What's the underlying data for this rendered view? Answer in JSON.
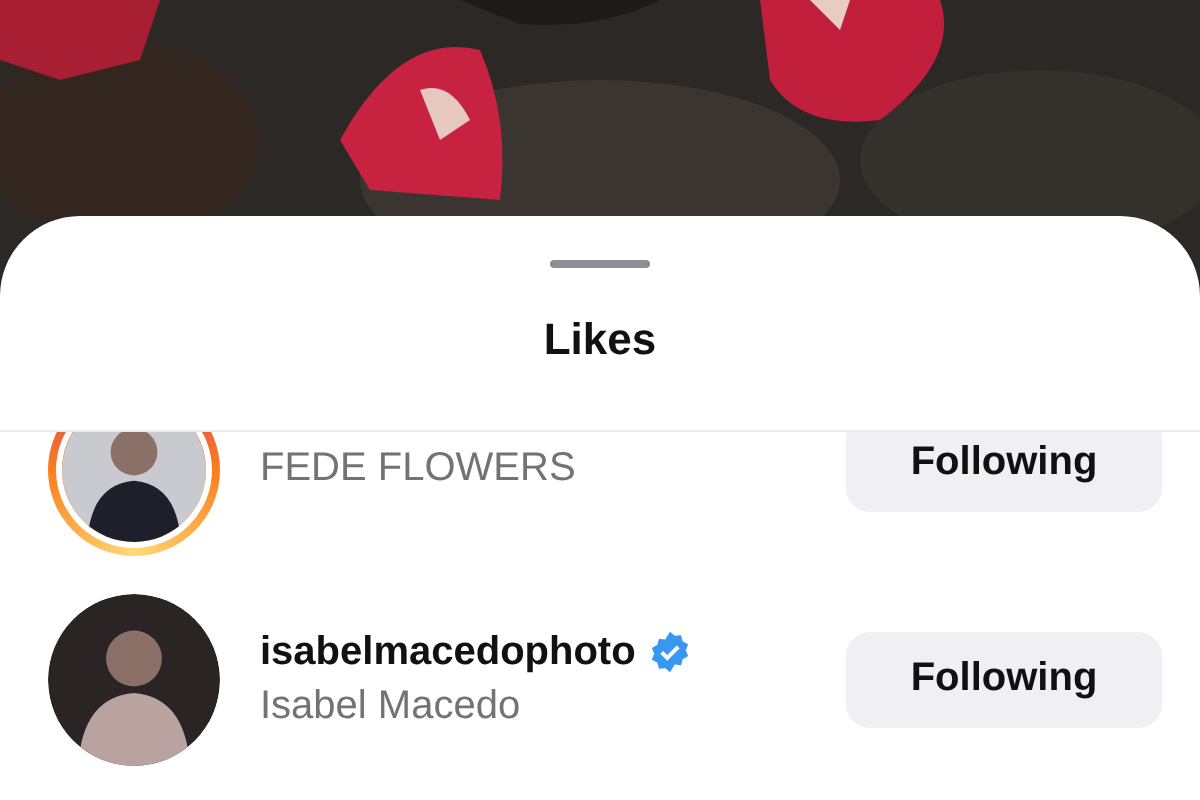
{
  "sheet": {
    "title": "Likes"
  },
  "likes": [
    {
      "display_name": "FEDE FLOWERS",
      "story_ring": true,
      "button": "Following"
    },
    {
      "username": "isabelmacedophoto",
      "display_name": "Isabel Macedo",
      "story_ring": false,
      "verified": true,
      "button": "Following"
    }
  ]
}
